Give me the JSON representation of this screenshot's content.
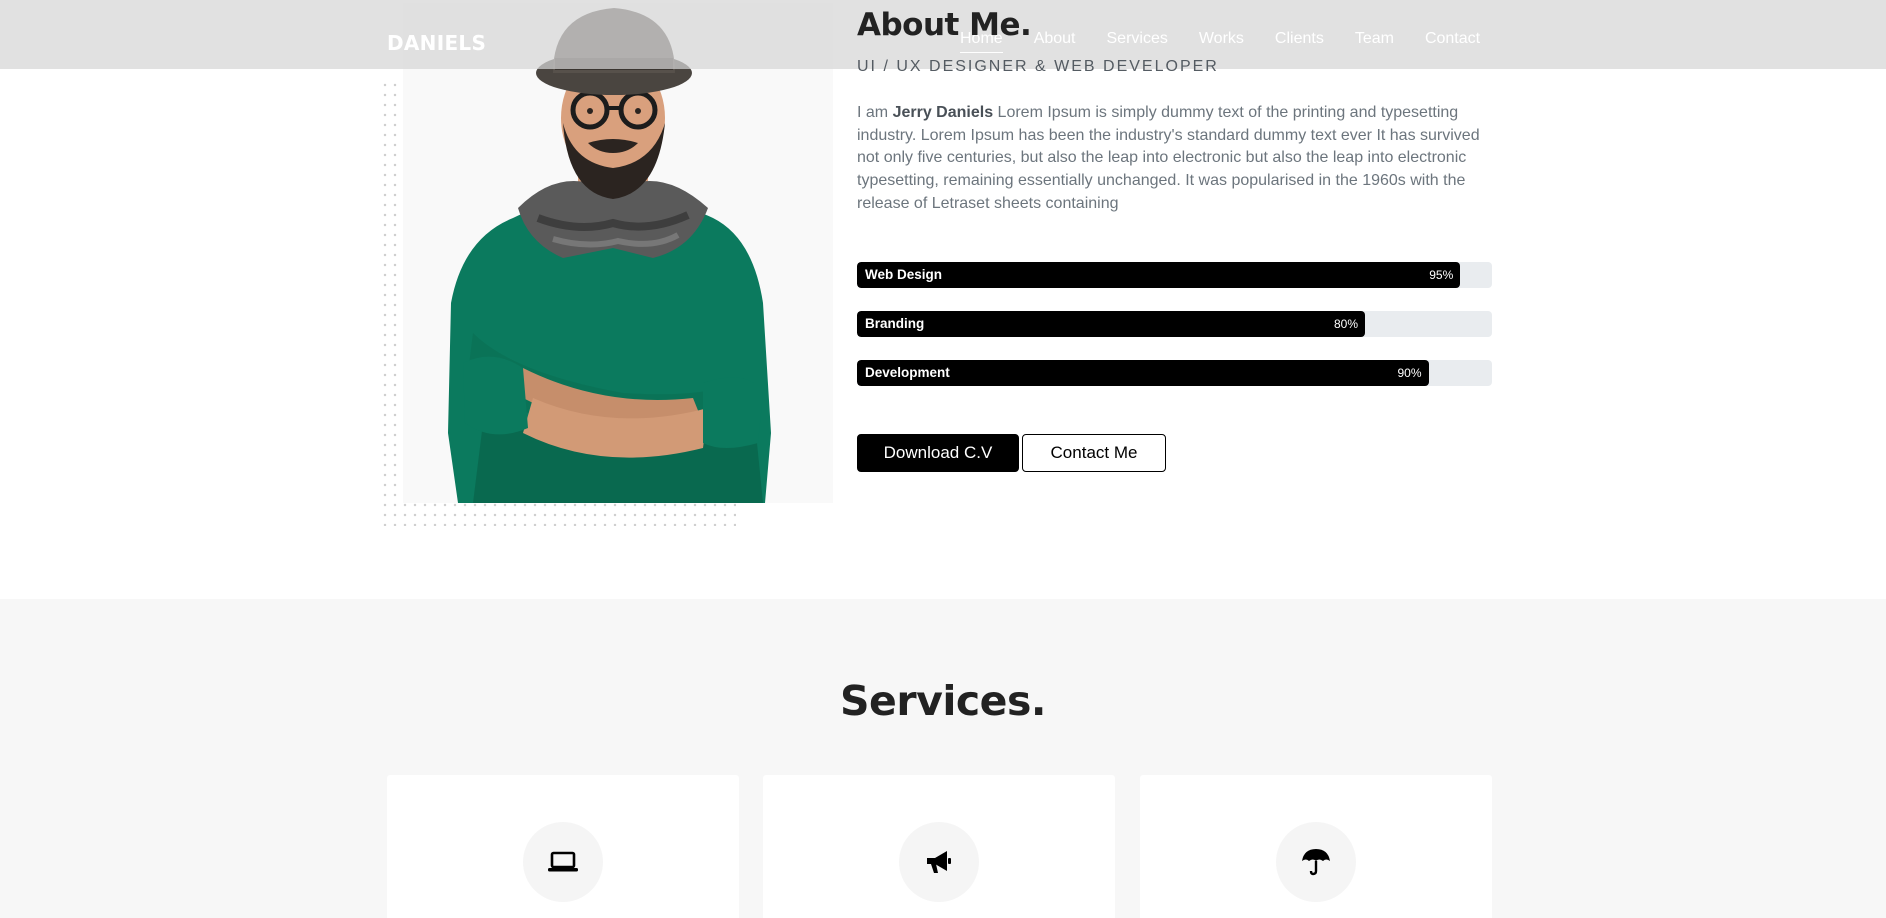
{
  "header": {
    "brand": "DANIELS",
    "nav": [
      {
        "label": "Home",
        "active": true
      },
      {
        "label": "About",
        "active": false
      },
      {
        "label": "Services",
        "active": false
      },
      {
        "label": "Works",
        "active": false
      },
      {
        "label": "Clients",
        "active": false
      },
      {
        "label": "Team",
        "active": false
      },
      {
        "label": "Contact",
        "active": false
      }
    ]
  },
  "about": {
    "title": "About Me.",
    "subtitle": "UI / UX DESIGNER & WEB DEVELOPER",
    "intro_prefix": "I am",
    "name": "Jerry Daniels",
    "text": "Lorem Ipsum is simply dummy text of the printing and typesetting industry. Lorem Ipsum has been the industry's standard dummy text ever It has survived not only five centuries, but also the leap into electronic but also the leap into electronic typesetting, remaining essentially unchanged. It was popularised in the 1960s with the release of Letraset sheets containing",
    "skills": [
      {
        "name": "Web Design",
        "percent_label": "95%",
        "value": 95
      },
      {
        "name": "Branding",
        "percent_label": "80%",
        "value": 80
      },
      {
        "name": "Development",
        "percent_label": "90%",
        "value": 90
      }
    ],
    "buttons": {
      "download_cv": "Download C.V",
      "contact_me": "Contact Me"
    }
  },
  "services": {
    "title": "Services.",
    "cards": [
      {
        "icon": "laptop-icon"
      },
      {
        "icon": "megaphone-icon"
      },
      {
        "icon": "umbrella-icon"
      }
    ]
  },
  "colors": {
    "accent": "#000000",
    "nav_overlay": "#d6d6d6",
    "skill_track": "#e9ecef",
    "sweater": "#0b7a5e",
    "section_bg": "#f7f7f7"
  }
}
